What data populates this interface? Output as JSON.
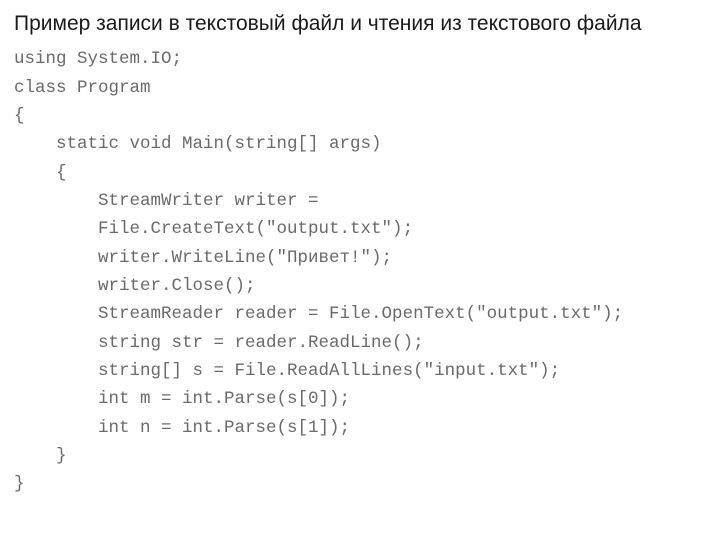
{
  "title": "Пример записи в текстовый файл и чтения из текстового файла",
  "code": {
    "l1": "using System.IO;",
    "l2": "class Program",
    "l3": "{",
    "l4": "    static void Main(string[] args)",
    "l5": "    {",
    "l6": "        StreamWriter writer =",
    "l7": "        File.CreateText(\"output.txt\");",
    "l8": "        writer.WriteLine(\"Привет!\");",
    "l9": "        writer.Close();",
    "l10": "        StreamReader reader = File.OpenText(\"output.txt\");",
    "l11": "        string str = reader.ReadLine();",
    "l12": "        string[] s = File.ReadAllLines(\"input.txt\");",
    "l13": "        int m = int.Parse(s[0]);",
    "l14": "        int n = int.Parse(s[1]);",
    "l15": "    }",
    "l16": "}"
  }
}
